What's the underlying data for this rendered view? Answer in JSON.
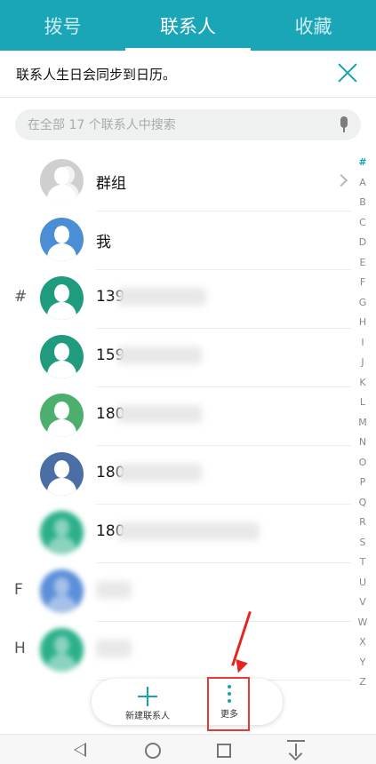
{
  "tabs": [
    {
      "label": "拨号",
      "active": false
    },
    {
      "label": "联系人",
      "active": true
    },
    {
      "label": "收藏",
      "active": false
    }
  ],
  "banner": {
    "text": "联系人生日会同步到日历。",
    "close_icon": "close-icon"
  },
  "search": {
    "placeholder": "在全部 17 个联系人中搜索",
    "value": "",
    "mic_icon": "microphone-icon"
  },
  "contacts": [
    {
      "name": "群组",
      "avatar_color": "#cfcfcf",
      "type": "group"
    },
    {
      "name": "我",
      "avatar_color": "#4a8fd6"
    },
    {
      "name": "139",
      "avatar_color": "#1f9b7e",
      "section": "#"
    },
    {
      "name": "159",
      "avatar_color": "#1f9b7e"
    },
    {
      "name": "180",
      "avatar_color": "#4caf6d"
    },
    {
      "name": "180",
      "avatar_color": "#4a6ea5"
    },
    {
      "name": "180",
      "avatar_color": "#2bb08a"
    },
    {
      "name": "",
      "avatar_color": "#5b8fd8",
      "section": "F"
    },
    {
      "name": "",
      "avatar_color": "#2bb08a",
      "section": "H"
    }
  ],
  "alphabet_index": [
    "#",
    "A",
    "B",
    "C",
    "D",
    "E",
    "F",
    "G",
    "H",
    "I",
    "J",
    "K",
    "L",
    "M",
    "N",
    "O",
    "P",
    "Q",
    "R",
    "S",
    "T",
    "U",
    "V",
    "W",
    "X",
    "Y",
    "Z"
  ],
  "fab": {
    "new_contact_label": "新建联系人",
    "more_label": "更多"
  },
  "accent_color": "#1aa6b7"
}
